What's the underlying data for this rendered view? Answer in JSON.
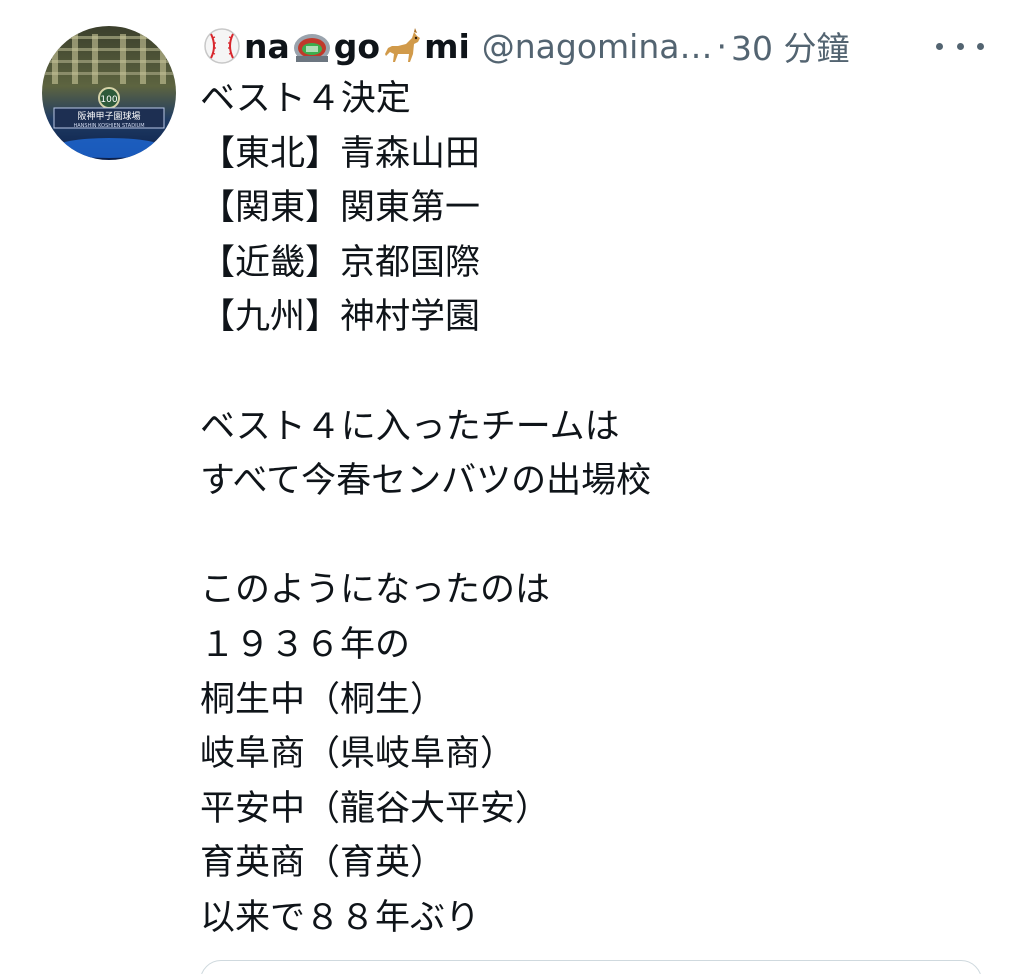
{
  "tweet": {
    "author": {
      "name_part1": "na",
      "name_part2": "go",
      "name_part3": "mi",
      "emoji1": "baseball-emoji",
      "emoji2": "stadium-emoji",
      "emoji3": "dog-emoji",
      "handle": "@nagomina…",
      "separator": "·",
      "time": "30 分鐘"
    },
    "avatar": {
      "sign_text": "阪神甲子園球場",
      "sign_subtext": "HANSHIN KOSHIEN STADIUM",
      "badge": "100"
    },
    "lines": [
      "ベスト４決定",
      "【東北】青森山田",
      "【関東】関東第一",
      "【近畿】京都国際",
      "【九州】神村学園",
      "",
      "ベスト４に入ったチームは",
      "すべて今春センバツの出場校",
      "",
      "このようになったのは",
      "１９３６年の",
      "桐生中（桐生）",
      "岐阜商（県岐阜商）",
      "平安中（龍谷大平安）",
      "育英商（育英）",
      "以来で８８年ぶり"
    ],
    "more_icon": "more-horizontal-icon"
  }
}
